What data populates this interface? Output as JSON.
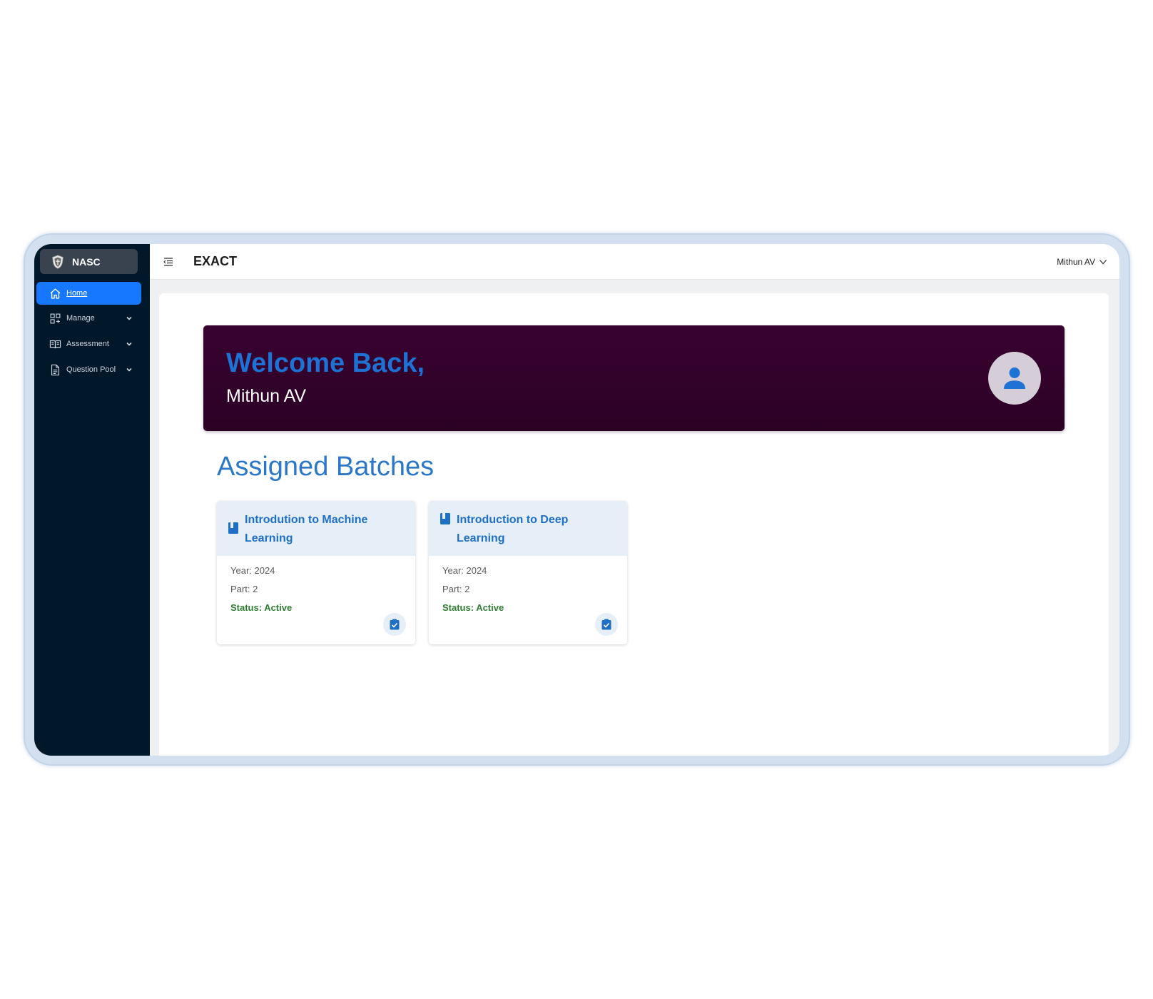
{
  "sidebar": {
    "brand": "NASC",
    "items": [
      {
        "label": "Home",
        "icon": "home-icon",
        "active": true
      },
      {
        "label": "Manage",
        "icon": "dashboard-icon"
      },
      {
        "label": "Assessment",
        "icon": "book-open-icon"
      },
      {
        "label": "Question Pool",
        "icon": "file-icon"
      }
    ]
  },
  "header": {
    "title": "EXACT",
    "user": "Mithun AV"
  },
  "welcome": {
    "title": "Welcome Back,",
    "name": "Mithun AV"
  },
  "section_title": "Assigned Batches",
  "batches": [
    {
      "name": "Introdution to Machine Learning",
      "year": "Year: 2024",
      "part": "Part: 2",
      "status": "Status: Active"
    },
    {
      "name": "Introduction to Deep Learning",
      "year": "Year: 2024",
      "part": "Part: 2",
      "status": "Status: Active"
    }
  ],
  "colors": {
    "sidebar_bg": "#01172a",
    "active_nav": "#1677ff",
    "banner_bg": "#380230",
    "accent_blue": "#1e72d4",
    "status_green": "#2e7d32"
  }
}
